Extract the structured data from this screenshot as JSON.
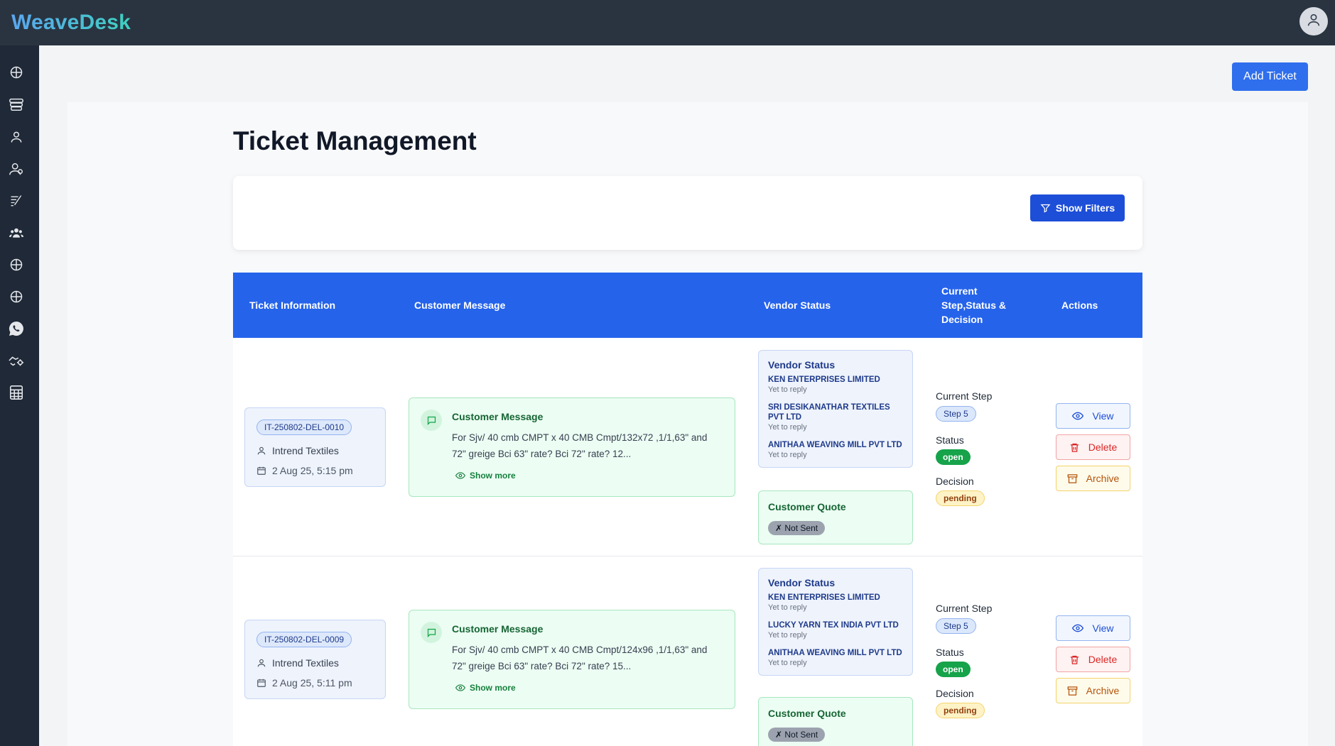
{
  "app": {
    "brand": "WeaveDesk"
  },
  "sidebar": {
    "items": [
      {
        "icon": "dashboard-icon"
      },
      {
        "icon": "inventory-icon"
      },
      {
        "icon": "user-icon"
      },
      {
        "icon": "users-icon"
      },
      {
        "icon": "edit-list-icon"
      },
      {
        "icon": "team-icon"
      },
      {
        "icon": "grid-icon"
      },
      {
        "icon": "grid-icon"
      },
      {
        "icon": "whatsapp-icon"
      },
      {
        "icon": "handshake-settings-icon"
      },
      {
        "icon": "calculator-icon"
      }
    ]
  },
  "header": {
    "add_ticket_label": "Add Ticket"
  },
  "page": {
    "title": "Ticket Management",
    "show_filters_label": "Show Filters"
  },
  "table": {
    "columns": {
      "ticket_info": "Ticket Information",
      "customer_message": "Customer Message",
      "vendor_status": "Vendor Status",
      "current_step": "Current Step,Status & Decision",
      "actions": "Actions"
    },
    "rows": [
      {
        "ticket_id": "IT-250802-DEL-0010",
        "customer": "Intrend Textiles",
        "date": "2 Aug 25, 5:15 pm",
        "message_title": "Customer Message",
        "message_text": "For Sjv/ 40 cmb CMPT x 40 CMB Cmpt/132x72 ,1/1,63\" and 72\" greige Bci 63\" rate? Bci 72\" rate? 12...",
        "show_more": "Show more",
        "vendor_title": "Vendor Status",
        "vendors": [
          {
            "name": "KEN ENTERPRISES LIMITED",
            "status": "Yet to reply"
          },
          {
            "name": "SRI DESIKANATHAR TEXTILES PVT LTD",
            "status": "Yet to reply"
          },
          {
            "name": "ANITHAA WEAVING MILL PVT LTD",
            "status": "Yet to reply"
          }
        ],
        "quote_title": "Customer Quote",
        "quote_status": "✗ Not Sent",
        "current_step_label": "Current Step",
        "step": "Step 5",
        "status_label": "Status",
        "status": "open",
        "decision_label": "Decision",
        "decision": "pending",
        "actions": {
          "view": "View",
          "delete": "Delete",
          "archive": "Archive"
        }
      },
      {
        "ticket_id": "IT-250802-DEL-0009",
        "customer": "Intrend Textiles",
        "date": "2 Aug 25, 5:11 pm",
        "message_title": "Customer Message",
        "message_text": "For Sjv/ 40 cmb CMPT x 40 CMB Cmpt/124x96 ,1/1,63\" and 72\" greige Bci 63\" rate? Bci 72\" rate? 15...",
        "show_more": "Show more",
        "vendor_title": "Vendor Status",
        "vendors": [
          {
            "name": "KEN ENTERPRISES LIMITED",
            "status": "Yet to reply"
          },
          {
            "name": "LUCKY YARN TEX INDIA PVT LTD",
            "status": "Yet to reply"
          },
          {
            "name": "ANITHAA WEAVING MILL PVT LTD",
            "status": "Yet to reply"
          }
        ],
        "quote_title": "Customer Quote",
        "quote_status": "✗ Not Sent",
        "current_step_label": "Current Step",
        "step": "Step 5",
        "status_label": "Status",
        "status": "open",
        "decision_label": "Decision",
        "decision": "pending",
        "actions": {
          "view": "View",
          "delete": "Delete",
          "archive": "Archive"
        }
      }
    ]
  },
  "colors": {
    "topbar": "#2a3441",
    "sidebar": "#1f2937",
    "primary": "#2563eb",
    "open": "#16a34a",
    "delete": "#dc2626",
    "archive": "#b45309"
  }
}
